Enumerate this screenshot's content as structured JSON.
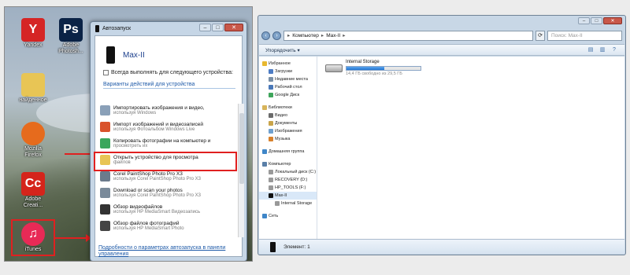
{
  "desktop": {
    "icons": [
      {
        "label": "Yandex",
        "color": "#d52525",
        "glyph": "Y"
      },
      {
        "label": "Adobe Photosh...",
        "color": "#0b2346",
        "glyph": "Ps"
      },
      {
        "label": "найденное",
        "color": "#e8c555",
        "glyph": ""
      },
      {
        "label": "Mozilla Firefox",
        "color": "#e66b1d",
        "glyph": ""
      },
      {
        "label": "Adobe Creati...",
        "color": "#d5241b",
        "glyph": "Cc"
      },
      {
        "label": "iTunes",
        "color": "#e82a56",
        "glyph": "♫"
      }
    ]
  },
  "autoplay": {
    "title": "Автозапуск",
    "buttons": {
      "min": "–",
      "max": "□",
      "close": "✕"
    },
    "device_name": "Max-II",
    "always_label": "Всегда выполнять для следующего устройства:",
    "section_label": "Варианты действий для устройства",
    "options": [
      {
        "title": "Импортировать изображения и видео,",
        "sub": "используя Windows",
        "color": "#8aa0b8"
      },
      {
        "title": "Импорт изображений и видеозаписей",
        "sub": "используя Фотоальбом Windows Live",
        "color": "#d9532c"
      },
      {
        "title": "Копировать фотографии на компьютер и",
        "sub": "просмотреть их",
        "color": "#3aa65c"
      },
      {
        "title": "Открыть устройство для просмотра",
        "sub": "файлов",
        "color": "#e8c555"
      },
      {
        "title": "Corel PaintShop Photo Pro X3",
        "sub": "используя Corel PaintShop Photo Pro X3",
        "color": "#6b7b8c"
      },
      {
        "title": "Download or scan your photos",
        "sub": "используя Corel PaintShop Photo Pro X3",
        "color": "#7a8a9a"
      },
      {
        "title": "Обзор видеофайлов",
        "sub": "используя HP MediaSmart Видеозапись",
        "color": "#333333"
      },
      {
        "title": "Обзор файлов фотографий",
        "sub": "используя HP MediaSmart Photo",
        "color": "#444444"
      }
    ],
    "more_link": "Подробности о параметрах автозапуска в панели управления"
  },
  "explorer": {
    "breadcrumb": [
      "Компьютер",
      "Max-II"
    ],
    "search_placeholder": "Поиск: Max-II",
    "toolbar_label": "Упорядочить ▾",
    "nav": [
      {
        "label": "Избранное",
        "color": "#e8b830",
        "indent": 0
      },
      {
        "label": "Загрузки",
        "color": "#4d7cc4",
        "indent": 1
      },
      {
        "label": "Недавние места",
        "color": "#7a8fa6",
        "indent": 1
      },
      {
        "label": "Рабочий стол",
        "color": "#4a78b8",
        "indent": 1
      },
      {
        "label": "Google Диск",
        "color": "#3ea55b",
        "indent": 1
      },
      {
        "gap": true
      },
      {
        "label": "Библиотеки",
        "color": "#d7b45a",
        "indent": 0
      },
      {
        "label": "Видео",
        "color": "#6b6b6b",
        "indent": 1
      },
      {
        "label": "Документы",
        "color": "#c9a44a",
        "indent": 1
      },
      {
        "label": "Изображения",
        "color": "#6fa0cf",
        "indent": 1
      },
      {
        "label": "Музыка",
        "color": "#d7812c",
        "indent": 1
      },
      {
        "gap": true
      },
      {
        "label": "Домашняя группа",
        "color": "#3f86c8",
        "indent": 0
      },
      {
        "gap": true
      },
      {
        "label": "Компьютер",
        "color": "#5a7fa8",
        "indent": 0
      },
      {
        "label": "Локальный диск (C:)",
        "color": "#999999",
        "indent": 1
      },
      {
        "label": "RECOVERY (D:)",
        "color": "#999999",
        "indent": 1
      },
      {
        "label": "HP_TOOLS (F:)",
        "color": "#999999",
        "indent": 1
      },
      {
        "label": "Max-II",
        "color": "#111111",
        "indent": 1,
        "selected": true
      },
      {
        "label": "Internal Storage",
        "color": "#999999",
        "indent": 2
      },
      {
        "gap": true
      },
      {
        "label": "Сеть",
        "color": "#3f86c8",
        "indent": 0
      }
    ],
    "drive": {
      "name": "Internal Storage",
      "free": "14,4 ГБ свободно из 29,5 ГБ",
      "used_fraction": 0.51
    },
    "status_text": "Элемент: 1"
  }
}
